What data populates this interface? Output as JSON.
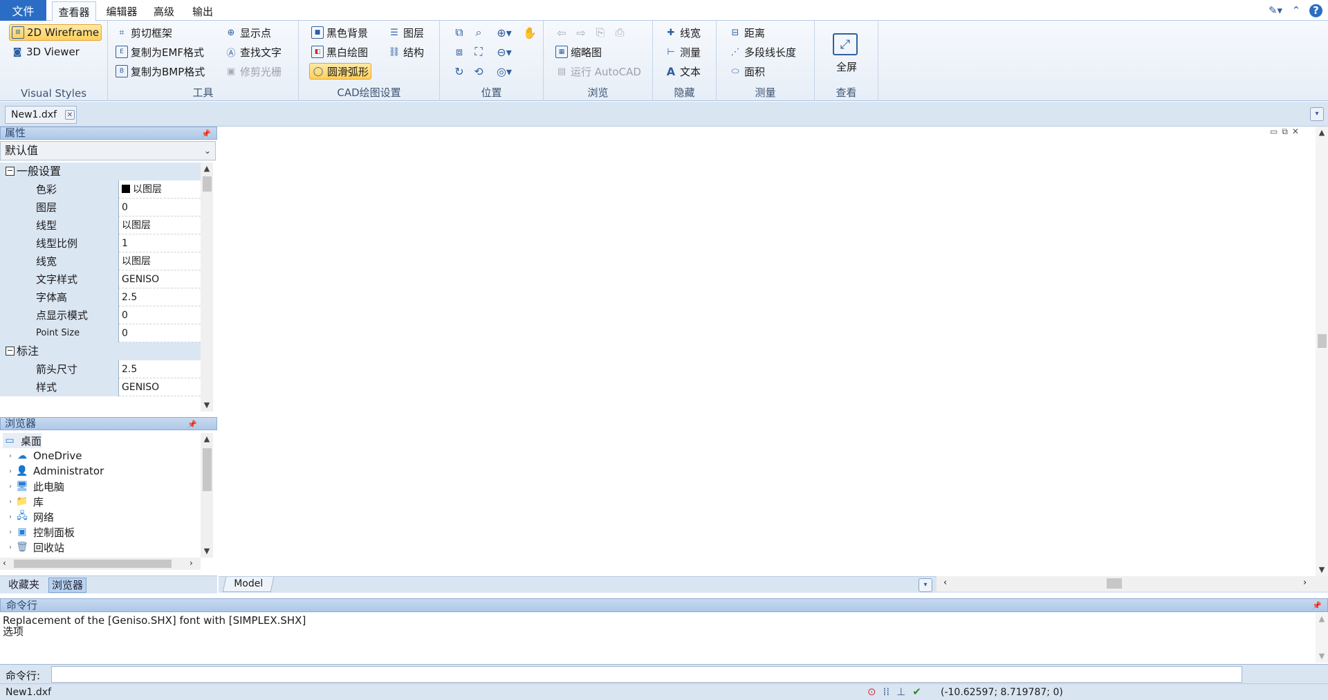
{
  "menu": {
    "file": "文件",
    "tabs": [
      "查看器",
      "编辑器",
      "高级",
      "输出"
    ]
  },
  "ribbon": {
    "visual_styles": {
      "label": "Visual Styles",
      "wireframe": "2D Wireframe",
      "viewer3d": "3D Viewer"
    },
    "tools": {
      "label": "工具",
      "clip_frame": "剪切框架",
      "copy_emf": "复制为EMF格式",
      "copy_bmp": "复制为BMP格式",
      "show_points": "显示点",
      "find_text": "查找文字",
      "trim_raster": "修剪光栅"
    },
    "cad_settings": {
      "label": "CAD绘图设置",
      "black_bg": "黑色背景",
      "bw_draw": "黑白绘图",
      "smooth_arc": "圆滑弧形",
      "layers": "图层",
      "structure": "结构"
    },
    "position": {
      "label": "位置"
    },
    "browse": {
      "label": "浏览",
      "thumbnail": "缩略图",
      "run_autocad": "运行 AutoCAD"
    },
    "hide": {
      "label": "隐藏",
      "lineweight": "线宽",
      "measure": "测量",
      "text": "文本"
    },
    "measure": {
      "label": "测量",
      "distance": "距离",
      "polyline_len": "多段线长度",
      "area": "面积"
    },
    "view": {
      "label": "查看",
      "fullscreen": "全屏"
    }
  },
  "document_tab": "New1.dxf",
  "properties": {
    "title": "属性",
    "combo_value": "默认值",
    "general": {
      "title": "一般设置",
      "rows": [
        {
          "name": "色彩",
          "value": "以图层"
        },
        {
          "name": "图层",
          "value": "0"
        },
        {
          "name": "线型",
          "value": "以图层"
        },
        {
          "name": "线型比例",
          "value": "1"
        },
        {
          "name": "线宽",
          "value": "以图层"
        },
        {
          "name": "文字样式",
          "value": "GENISO"
        },
        {
          "name": "字体高",
          "value": "2.5"
        },
        {
          "name": "点显示模式",
          "value": "0"
        },
        {
          "name": "Point Size",
          "value": "0"
        }
      ]
    },
    "dimension": {
      "title": "标注",
      "rows": [
        {
          "name": "箭头尺寸",
          "value": "2.5"
        },
        {
          "name": "样式",
          "value": "GENISO"
        }
      ]
    }
  },
  "browser": {
    "title": "浏览器",
    "items": [
      "桌面",
      "OneDrive",
      "Administrator",
      "此电脑",
      "库",
      "网络",
      "控制面板",
      "回收站"
    ]
  },
  "panel_tabs": [
    "收藏夹",
    "浏览器"
  ],
  "model_tab": "Model",
  "command": {
    "title": "命令行",
    "output_lines": [
      "Replacement of the [Geniso.SHX] font with [SIMPLEX.SHX]",
      "选项"
    ],
    "prompt": "命令行:",
    "input_value": ""
  },
  "status": {
    "file": "New1.dxf",
    "coords": "(-10.62597; 8.719787; 0)"
  },
  "colors": {
    "accent": "#2b6dc4",
    "selected": "#ffcf5c",
    "panel": "#dae5f2"
  }
}
